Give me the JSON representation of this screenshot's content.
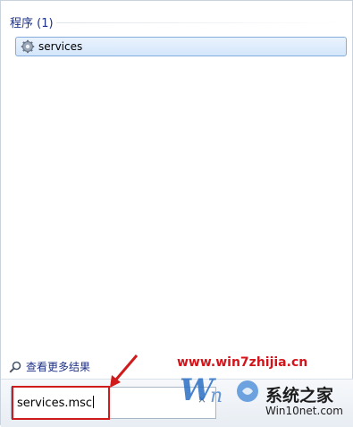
{
  "results": {
    "group_header": "程序 (1)",
    "items": [
      {
        "label": "services",
        "icon": "gear-icon"
      }
    ]
  },
  "see_more": {
    "label": "查看更多结果",
    "icon": "search-icon"
  },
  "search": {
    "value": "services.msc",
    "clear_glyph": "×"
  },
  "watermark": {
    "url": "www.win7zhijia.cn",
    "site_name": "系统之家",
    "domain": "Win10net.com",
    "accent_color": "#d4141b"
  },
  "annotation": {
    "box_color": "#cf1b1b",
    "arrow_color": "#cf1b1b"
  }
}
